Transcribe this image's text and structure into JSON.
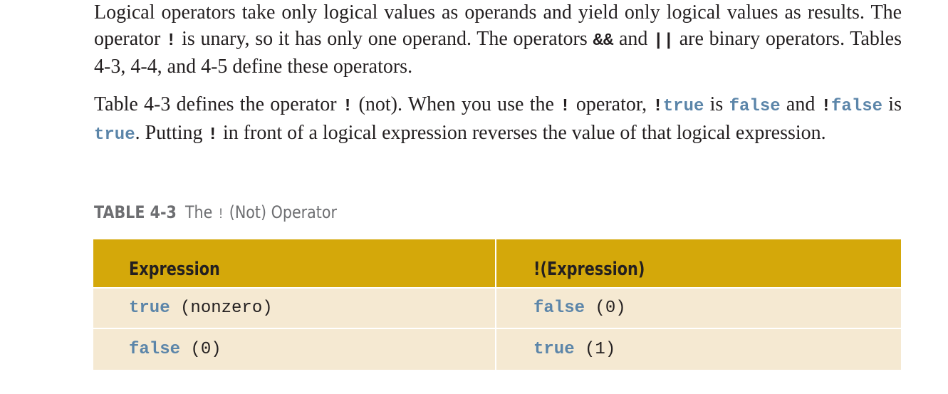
{
  "paragraph1": {
    "s1": "Logical operators take only logical values as operands and yield only logical values as results. The operator ",
    "op_not": "!",
    "s2": " is unary, so it has only one operand. The operators ",
    "op_and": "&&",
    "s3": " and ",
    "op_or": "||",
    "s4": " are binary operators. Tables 4-3, 4-4, and 4-5 define these operators."
  },
  "paragraph2": {
    "s1": "Table 4-3 defines the operator ",
    "op1": "!",
    "s2": " (not). When you use the ",
    "op2": "!",
    "s3": " operator, ",
    "op3": "!",
    "kw_true1": "true",
    "s4": " is ",
    "kw_false1": "false",
    "s5": " and ",
    "op4": "!",
    "kw_false2": "false",
    "s6": " is ",
    "kw_true2": "true",
    "s7": ". Putting ",
    "op5": "!",
    "s8": " in front of a logical expression reverses the value of that logical expression."
  },
  "table_caption": {
    "number": "TABLE 4-3",
    "title_before": "The ",
    "operator": "!",
    "title_after": " (Not) Operator"
  },
  "table": {
    "headers": [
      "Expression",
      "!(Expression)"
    ],
    "rows": [
      [
        {
          "keyword": "true",
          "rest": " (nonzero)"
        },
        {
          "keyword": "false",
          "rest": " (0)"
        }
      ],
      [
        {
          "keyword": "false",
          "rest": " (0)"
        },
        {
          "keyword": "true",
          "rest": " (1)"
        }
      ]
    ]
  },
  "colors": {
    "text": "#231f20",
    "keyword": "#5b85a9",
    "caption": "#6d6e71",
    "header_bg": "#d4a80a",
    "row_bg": "#f5e9d2"
  }
}
